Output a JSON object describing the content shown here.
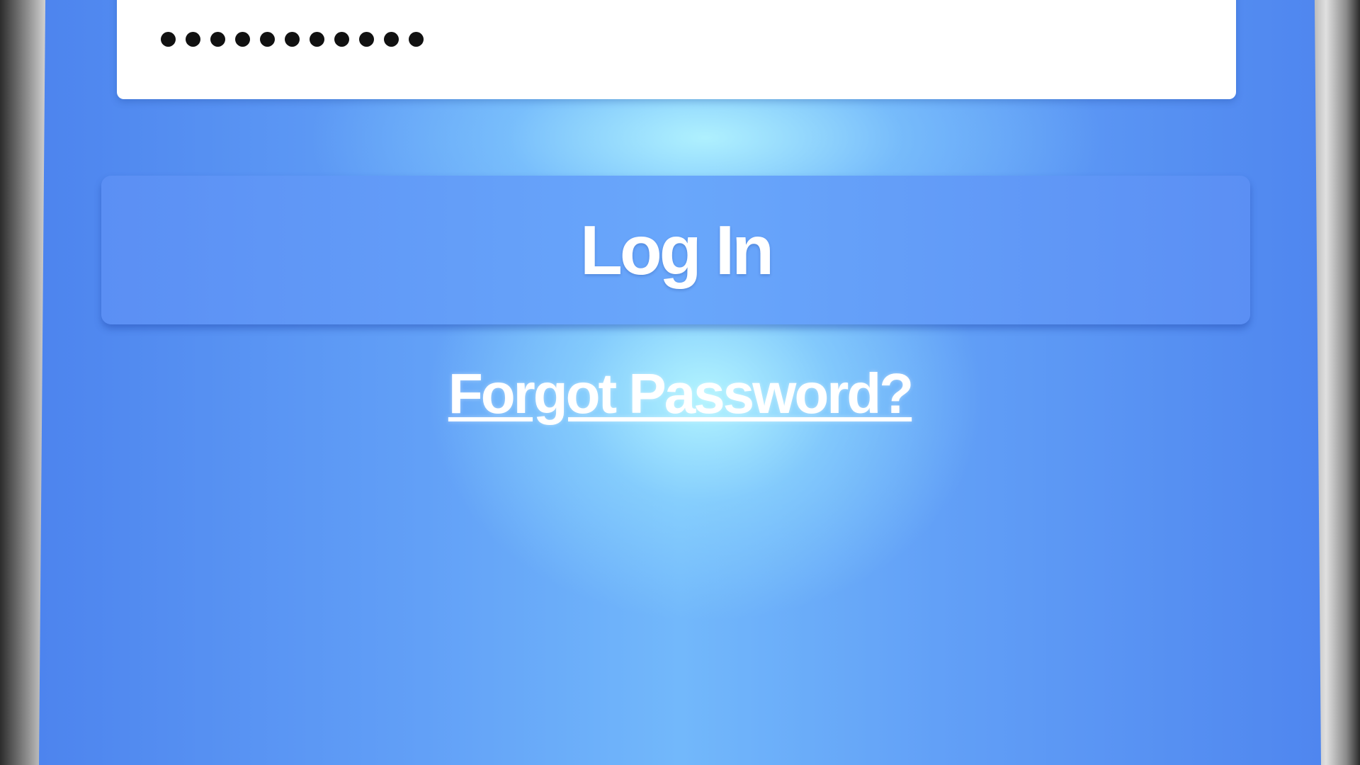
{
  "password": {
    "masked_value": "●●●●●●●●●●●",
    "dot_count": 11
  },
  "login": {
    "button_label": "Log In"
  },
  "links": {
    "forgot_password": "Forgot Password?"
  },
  "colors": {
    "background_blue": "#62a0f7",
    "button_blue": "#5b8ff4",
    "text_white": "#ffffff",
    "field_white": "#ffffff"
  }
}
